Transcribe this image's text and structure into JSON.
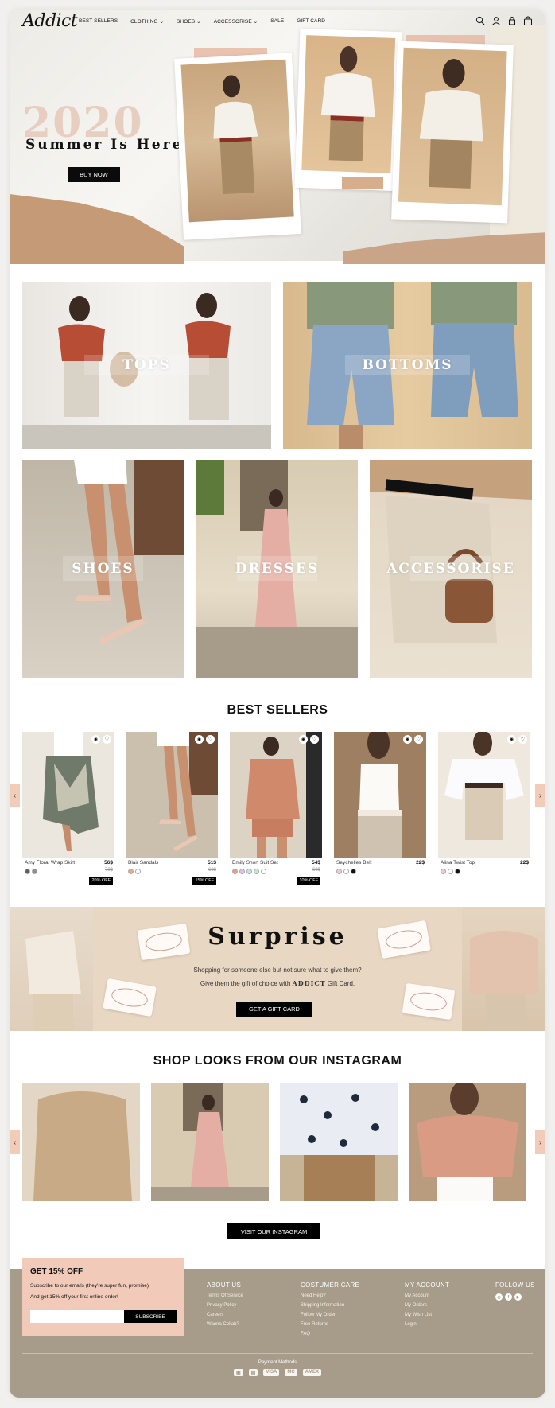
{
  "header": {
    "logo": "Addict",
    "nav": [
      "BEST SELLERS",
      "CLOTHING",
      "SHOES",
      "ACCESSORISE",
      "SALE",
      "GIFT CARD"
    ],
    "nav_dropdown_marker": "⌄"
  },
  "hero": {
    "year": "2020",
    "headline": "Summer Is Here",
    "button": "BUY NOW"
  },
  "categories": [
    {
      "label": "TOPS"
    },
    {
      "label": "BOTTOMS"
    },
    {
      "label": "SHOES"
    },
    {
      "label": "DRESSES"
    },
    {
      "label": "ACCESSORISE"
    }
  ],
  "best_sellers": {
    "title": "BEST SELLERS",
    "products": [
      {
        "name": "Amy Floral Wrap Skirt",
        "price": "56$",
        "old_price": "70$",
        "discount": "20% OFF",
        "swatches": [
          "#5b5f63",
          "#8d8f91"
        ]
      },
      {
        "name": "Blair Sandals",
        "price": "51$",
        "old_price": "60$",
        "discount": "15% OFF",
        "swatches": [
          "#e8a98c",
          "#ffffff"
        ]
      },
      {
        "name": "Emily Short Suit Set",
        "price": "54$",
        "old_price": "60$",
        "discount": "10% OFF",
        "swatches": [
          "#e5a184",
          "#d9c4e6",
          "#c8dff0",
          "#c9e5c8",
          "#ffffff"
        ]
      },
      {
        "name": "Seychelles Belt",
        "price": "22$",
        "old_price": "",
        "discount": "",
        "swatches": [
          "#f1c9cf",
          "#ffffff",
          "#111111"
        ]
      },
      {
        "name": "Alina Twist Top",
        "price": "22$",
        "old_price": "",
        "discount": "",
        "swatches": [
          "#f1c9cf",
          "#ffffff",
          "#111111"
        ]
      }
    ]
  },
  "surprise": {
    "title": "Surprise",
    "line1": "Shopping for someone else but not sure what to give them?",
    "line2_pre": "Give them the gift of choice with",
    "line2_brand": "ADDICT",
    "line2_post": "Gift Card.",
    "button": "GET A GIFT CARD"
  },
  "instagram": {
    "title": "SHOP LOOKS FROM OUR INSTAGRAM",
    "button": "VISIT OUR INSTAGRAM"
  },
  "footer": {
    "promo_title": "GET 15% OFF",
    "promo_line1": "Subscribe to our emails (they're super fun, promise)",
    "promo_line2": "And get 15% off your first online order!",
    "subscribe": "SUBSCRIBE",
    "about": {
      "title": "ABOUT US",
      "links": [
        "Terms Of Service",
        "Privacy Policy",
        "Careers",
        "Wanna Collab?"
      ]
    },
    "care": {
      "title": "COSTUMER CARE",
      "links": [
        "Need Help?",
        "Shipping Information",
        "Follow My Order",
        "Free Returns",
        "FAQ"
      ]
    },
    "account": {
      "title": "MY ACCOUNT",
      "links": [
        "My Account",
        "My Orders",
        "My Wish List",
        "Login"
      ]
    },
    "follow": {
      "title": "FOLLOW US"
    },
    "payment_label": "Payment Methods",
    "payment": [
      "VISA",
      "MC",
      "AMEX"
    ]
  },
  "colors": {
    "accent": "#f2cab9",
    "footer": "#a79c89",
    "gift_bg": "#e8d7c3"
  }
}
